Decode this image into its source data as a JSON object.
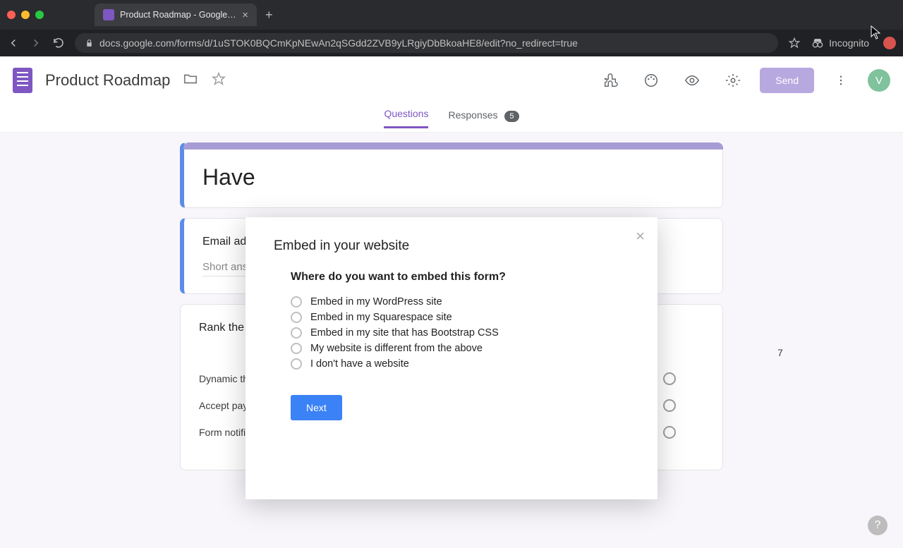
{
  "browser": {
    "tab_title": "Product Roadmap - Google Form",
    "url": "docs.google.com/forms/d/1uSTOK0BQCmKpNEwAn2qSGdd2ZVB9yLRgiyDbBkoaHE8/edit?no_redirect=true",
    "incognito_label": "Incognito"
  },
  "appbar": {
    "title": "Product Roadmap",
    "send_label": "Send",
    "avatar_initial": "V"
  },
  "tabs": {
    "questions": "Questions",
    "responses": "Responses",
    "responses_count": "5"
  },
  "form": {
    "header_title": "Have",
    "email_q": "Email add",
    "email_placeholder": "Short answ",
    "rank_q": "Rank the",
    "grid": {
      "col_last": "7",
      "rows": [
        "Dynamic th…",
        "Accept pay…",
        "Form notifi…"
      ]
    }
  },
  "modal": {
    "title": "Embed in your website",
    "prompt": "Where do you want to embed this form?",
    "options": [
      "Embed in my WordPress site",
      "Embed in my Squarespace site",
      "Embed in my site that has Bootstrap CSS",
      "My website is different from the above",
      "I don't have a website"
    ],
    "next": "Next"
  },
  "help": "?"
}
